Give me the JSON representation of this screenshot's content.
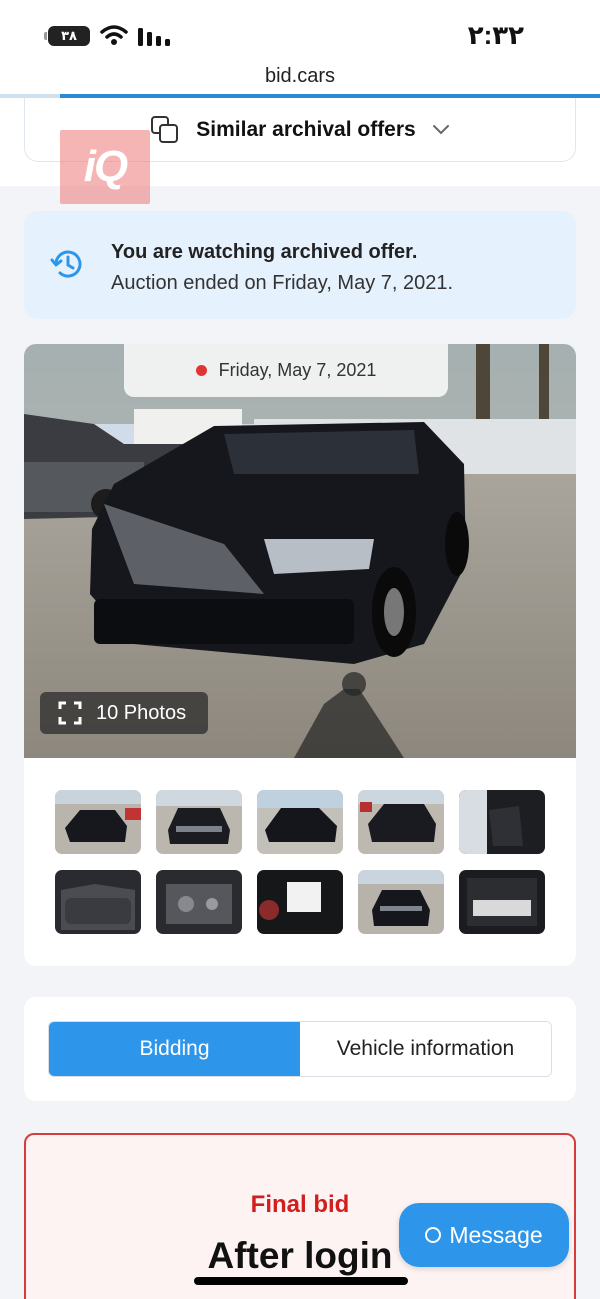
{
  "status_bar": {
    "battery": "۳۸",
    "time": "۲:۳۲"
  },
  "browser": {
    "url": "bid.cars"
  },
  "header": {
    "similar_offers_label": "Similar archival offers"
  },
  "watermark": {
    "text": "iQ"
  },
  "notice": {
    "title": "You are watching archived offer.",
    "subtitle": "Auction ended on Friday, May 7, 2021."
  },
  "gallery": {
    "date": "Friday, May 7, 2021",
    "photos_count_label": "10 Photos",
    "thumbnails": [
      "front-left damage",
      "front view",
      "rear-left",
      "rear",
      "interior front",
      "interior rear",
      "engine bay",
      "instrument cluster",
      "front view 2",
      "label sticker"
    ]
  },
  "tabs": {
    "bidding": "Bidding",
    "vehicle_information": "Vehicle information",
    "active": "Bidding"
  },
  "final_bid": {
    "label": "Final bid",
    "value": "After login"
  },
  "message_button": {
    "label": "Message"
  },
  "colors": {
    "accent_blue": "#2d96ea",
    "notice_bg": "#e5f1fc",
    "bid_red": "#d11f1f"
  }
}
